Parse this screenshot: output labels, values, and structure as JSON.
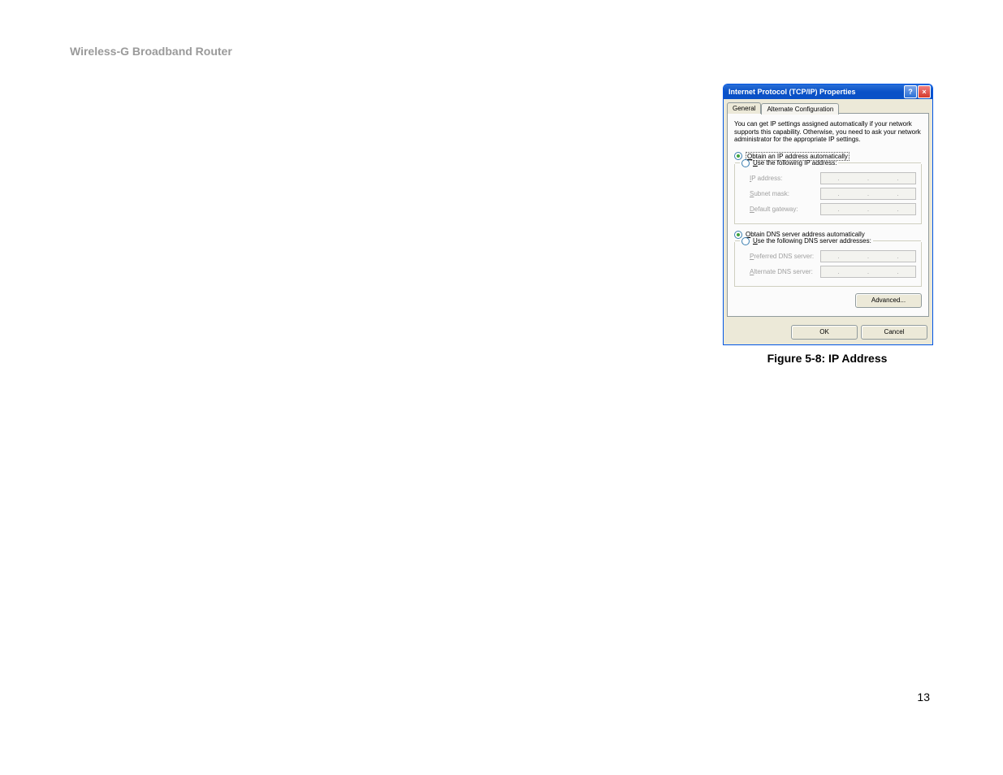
{
  "page": {
    "header": "Wireless-G Broadband Router",
    "number": "13"
  },
  "figure": {
    "caption": "Figure 5-8: IP Address"
  },
  "dialog": {
    "title": "Internet Protocol (TCP/IP) Properties",
    "help_icon": "?",
    "close_icon": "×",
    "tabs": {
      "general": "General",
      "alternate": "Alternate Configuration"
    },
    "description": "You can get IP settings assigned automatically if your network supports this capability. Otherwise, you need to ask your network administrator for the appropriate IP settings.",
    "ip": {
      "auto": "Obtain an IP address automatically",
      "manual": "Use the following IP address:",
      "ip_label": "IP address:",
      "subnet_label": "Subnet mask:",
      "gateway_label": "Default gateway:"
    },
    "dns": {
      "auto": "Obtain DNS server address automatically",
      "manual": "Use the following DNS server addresses:",
      "preferred_label": "Preferred DNS server:",
      "alternate_label": "Alternate DNS server:"
    },
    "buttons": {
      "advanced": "Advanced...",
      "ok": "OK",
      "cancel": "Cancel"
    }
  }
}
